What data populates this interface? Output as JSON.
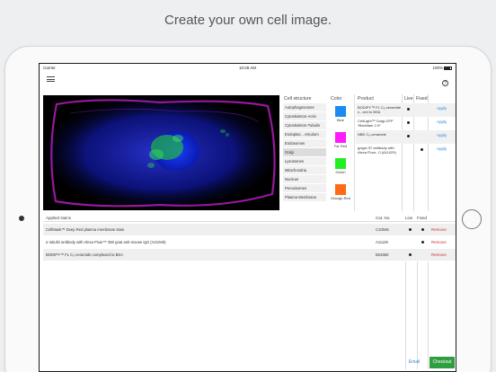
{
  "headline": "Create your own cell image.",
  "status_bar": {
    "carrier": "Carrier",
    "time": "10:28 AM",
    "battery": "100%"
  },
  "icons": {
    "menu": "hamburger-menu-icon",
    "help": "help-icon",
    "wifi": "wifi-icon",
    "battery": "battery-icon"
  },
  "help_glyph": "?",
  "headers": {
    "cell_structure": "Cell structure",
    "color": "Color",
    "product": "Product",
    "live": "Live",
    "fixed": "Fixed"
  },
  "cell_structures": [
    {
      "label": "Autophagosomes",
      "selected": false
    },
    {
      "label": "Cytoskeleton-Actin",
      "selected": false
    },
    {
      "label": "Cytoskeleton-Tubulin",
      "selected": false
    },
    {
      "label": "Endoplas... eticulum",
      "selected": false
    },
    {
      "label": "Endosomes",
      "selected": false
    },
    {
      "label": "Golgi",
      "selected": true
    },
    {
      "label": "Lysosomes",
      "selected": false
    },
    {
      "label": "Mitochondria",
      "selected": false
    },
    {
      "label": "Nucleus",
      "selected": false
    },
    {
      "label": "Peroxisomes",
      "selected": false
    },
    {
      "label": "Plasma Membrane",
      "selected": false
    }
  ],
  "colors": [
    {
      "label": "Blue",
      "hex": "#1a8cf0"
    },
    {
      "label": "Far Red",
      "hex": "#ff19ff"
    },
    {
      "label": "Green",
      "hex": "#22ee22"
    },
    {
      "label": "Orange-Red",
      "hex": "#ff6a14"
    }
  ],
  "products": [
    {
      "name": "BODIPY™ FL C₅-ceramide c...xed to BSA",
      "live": true,
      "fixed": false,
      "action": "Apply"
    },
    {
      "name": "CellLight™ Golgi-GFP *BacMam 2.0*",
      "live": true,
      "fixed": false,
      "action": "Apply"
    },
    {
      "name": "NBD C₆-ceramide",
      "live": true,
      "fixed": false,
      "action": "Apply"
    },
    {
      "name": "golgin 97 antibody with Alexa Fluor...0 (A11029)",
      "live": false,
      "fixed": true,
      "action": "Apply"
    }
  ],
  "applied": {
    "title": "Applied stains",
    "headers": {
      "cat": "Cat. No.",
      "live": "Live",
      "fixed": "Fixed"
    },
    "rows": [
      {
        "name": "CellMask™ Deep Red plasma membrane stain",
        "cat": "C10046",
        "live": true,
        "fixed": true,
        "action": "Remove"
      },
      {
        "name": "α tubulin antibody with Alexa Fluor™ 350 goat anti-mouse IgG (A21049)",
        "cat": "A11126",
        "live": false,
        "fixed": true,
        "action": "Remove"
      },
      {
        "name": "BODIPY™ FL C₅-ceramide complexed to BSA",
        "cat": "B22650",
        "live": true,
        "fixed": false,
        "action": "Remove"
      }
    ]
  },
  "buttons": {
    "email": "Email",
    "checkout": "Checkout"
  }
}
